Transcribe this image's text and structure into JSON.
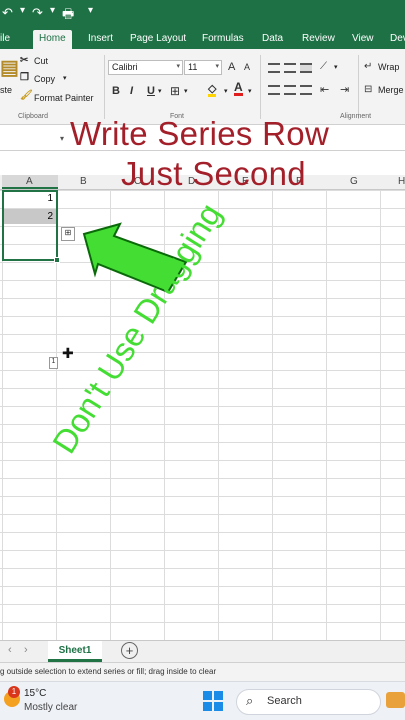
{
  "tabs": [
    "File",
    "Home",
    "Insert",
    "Page Layout",
    "Formulas",
    "Data",
    "Review",
    "View",
    "Developer"
  ],
  "tab_visible": [
    "ile",
    "Home",
    "Insert",
    "Page Layout",
    "Formulas",
    "Data",
    "Review",
    "View",
    "Dev"
  ],
  "active_tab": "Home",
  "ribbon": {
    "paste_label": "ste",
    "cut_label": "Cut",
    "copy_label": "Copy",
    "format_painter_label": "Format Painter",
    "clipboard_group": "Clipboard",
    "font_name": "Calibri",
    "font_size": "11",
    "font_group": "Font",
    "bold": "B",
    "italic": "I",
    "underline": "U",
    "grow_font": "A",
    "shrink_font": "A",
    "font_color": "A",
    "wrap_label": "Wrap",
    "merge_label": "Merge",
    "alignment_group": "Alignment"
  },
  "columns": [
    "A",
    "B",
    "C",
    "D",
    "E",
    "F",
    "G",
    "H"
  ],
  "cells": [
    {
      "ref": "A1",
      "value": "1"
    },
    {
      "ref": "A2",
      "value": "2"
    }
  ],
  "fill_tip_value": "1",
  "overlay": {
    "title_line1": "Write Series Row",
    "title_line2": "Just Second",
    "diagonal": "Don't Use Dragging",
    "arrow_color": "#44dd33",
    "title_color": "#a3202a"
  },
  "sheet_tab": "Sheet1",
  "add_sheet": "+",
  "status_text": "g outside selection to extend series or fill; drag inside to clear",
  "taskbar": {
    "temperature": "15°C",
    "weather": "Mostly clear",
    "weather_badge": "1",
    "search_placeholder": "Search"
  },
  "colors": {
    "excel_green": "#1e7145",
    "selection": "#217346"
  }
}
